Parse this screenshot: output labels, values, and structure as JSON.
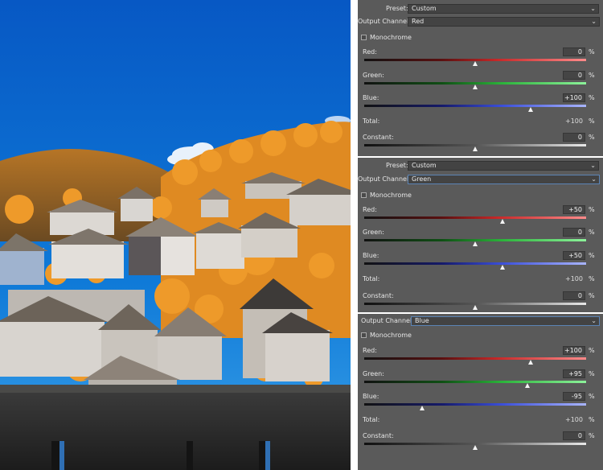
{
  "panels": [
    {
      "id": "red",
      "has_preset": true,
      "preset_label": "Preset:",
      "preset_value": "Custom",
      "channel_label": "Output Channel:",
      "channel_value": "Red",
      "channel_focused": false,
      "mono_label": "Monochrome",
      "sliders": [
        {
          "label": "Red:",
          "value": "0",
          "pct": 0,
          "kind": "red"
        },
        {
          "label": "Green:",
          "value": "0",
          "pct": 0,
          "kind": "green"
        },
        {
          "label": "Blue:",
          "value": "+100",
          "pct": 100,
          "kind": "blue"
        }
      ],
      "total_label": "Total:",
      "total_value": "+100",
      "constant_label": "Constant:",
      "constant_value": "0",
      "constant_pct": 0,
      "unit": "%"
    },
    {
      "id": "green",
      "has_preset": true,
      "preset_label": "Preset:",
      "preset_value": "Custom",
      "channel_label": "Output Channel:",
      "channel_value": "Green",
      "channel_focused": true,
      "mono_label": "Monochrome",
      "sliders": [
        {
          "label": "Red:",
          "value": "+50",
          "pct": 50,
          "kind": "red"
        },
        {
          "label": "Green:",
          "value": "0",
          "pct": 0,
          "kind": "green"
        },
        {
          "label": "Blue:",
          "value": "+50",
          "pct": 50,
          "kind": "blue"
        }
      ],
      "total_label": "Total:",
      "total_value": "+100",
      "constant_label": "Constant:",
      "constant_value": "0",
      "constant_pct": 0,
      "unit": "%"
    },
    {
      "id": "blue",
      "has_preset": false,
      "channel_label": "Output Channel:",
      "channel_value": "Blue",
      "channel_focused": true,
      "mono_label": "Monochrome",
      "sliders": [
        {
          "label": "Red:",
          "value": "+100",
          "pct": 100,
          "kind": "red"
        },
        {
          "label": "Green:",
          "value": "+95",
          "pct": 95,
          "kind": "green"
        },
        {
          "label": "Blue:",
          "value": "-95",
          "pct": -95,
          "kind": "blue"
        }
      ],
      "total_label": "Total:",
      "total_value": "+100",
      "constant_label": "Constant:",
      "constant_value": "0",
      "constant_pct": 0,
      "unit": "%"
    }
  ],
  "colors": {
    "panel_bg": "#5a5a5a",
    "field_bg": "#434343",
    "focus_border": "#5b84b5",
    "sky": "#0b6fd0",
    "foliage": "#e2861c"
  },
  "icons": {
    "dropdown": "chevron-down-icon",
    "thumb": "slider-thumb-icon",
    "checkbox": "checkbox-icon"
  }
}
